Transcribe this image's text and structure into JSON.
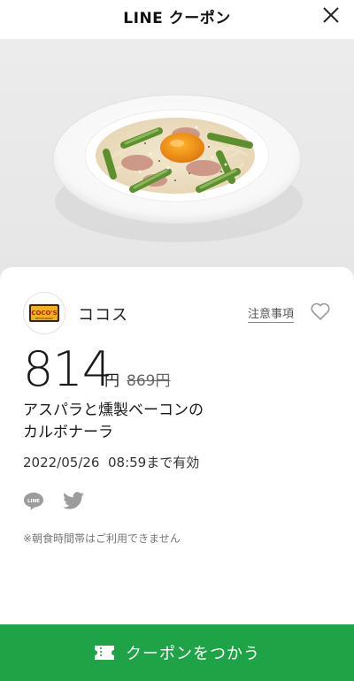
{
  "header": {
    "title": "LINE クーポン",
    "close_icon": "close-icon"
  },
  "hero": {
    "image": "carbonara-pasta-photo"
  },
  "store": {
    "logo_text": "COCO'S",
    "logo_subtext": "RESTAURANT",
    "name": "ココス",
    "notice_link": "注意事項"
  },
  "offer": {
    "price": "814",
    "currency": "円",
    "original_price": "869円",
    "title_line1": "アスパラと燻製ベーコンの",
    "title_line2": "カルボナーラ",
    "valid_until": "2022/05/26  08:59まで有効",
    "note": "※朝食時間帯はご利用できません"
  },
  "share": {
    "line_label": "LINE",
    "twitter_icon": "twitter-icon"
  },
  "cta": {
    "label": "クーポンをつかう",
    "icon": "ticket-icon",
    "color": "#1fa347"
  },
  "colors": {
    "accent": "#1fa347",
    "background": "#ffffff",
    "hero_bg": "#ececec"
  }
}
